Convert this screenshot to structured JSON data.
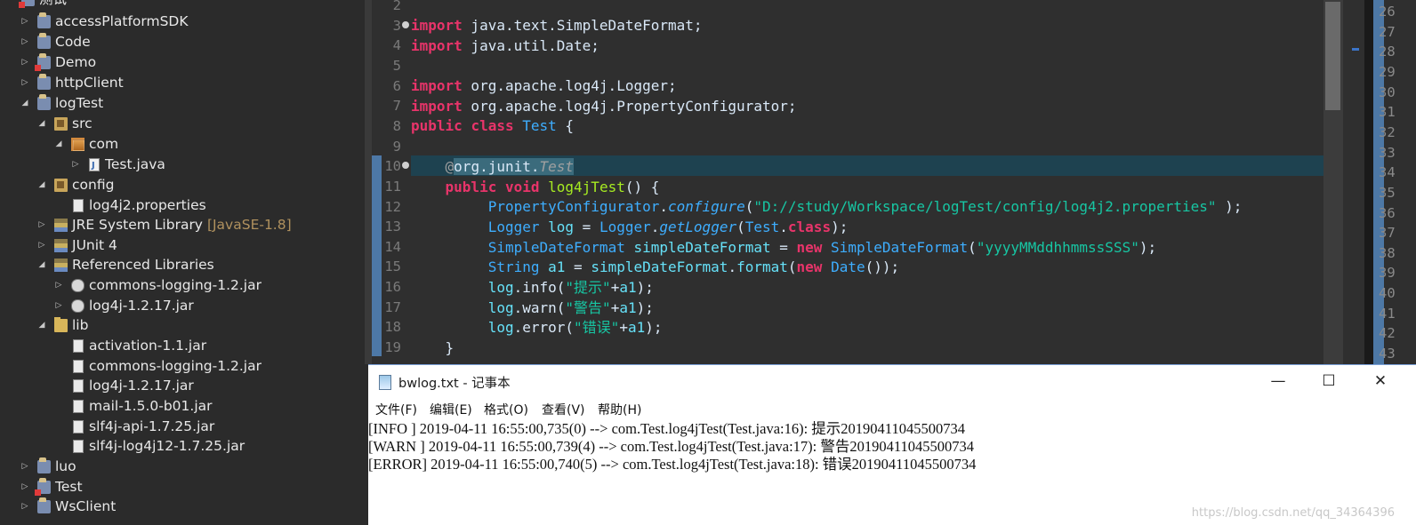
{
  "explorer": {
    "header_partial": "测试",
    "items": [
      {
        "label": "accessPlatformSDK",
        "icon": "project-icon"
      },
      {
        "label": "Code",
        "icon": "project-icon"
      },
      {
        "label": "Demo",
        "icon": "project-error-icon"
      },
      {
        "label": "httpClient",
        "icon": "project-icon"
      },
      {
        "label": "logTest",
        "icon": "project-icon"
      },
      {
        "label": "src",
        "icon": "source-folder-icon"
      },
      {
        "label": "com",
        "icon": "package-icon"
      },
      {
        "label": "Test.java",
        "icon": "java-file-icon"
      },
      {
        "label": "config",
        "icon": "source-folder-icon"
      },
      {
        "label": "log4j2.properties",
        "icon": "properties-file-icon"
      },
      {
        "label": "JRE System Library",
        "decor": "[JavaSE-1.8]",
        "icon": "library-icon"
      },
      {
        "label": "JUnit 4",
        "icon": "library-icon"
      },
      {
        "label": "Referenced Libraries",
        "icon": "library-icon"
      },
      {
        "label": "commons-logging-1.2.jar",
        "icon": "jar-icon"
      },
      {
        "label": "log4j-1.2.17.jar",
        "icon": "jar-icon"
      },
      {
        "label": "lib",
        "icon": "folder-icon"
      },
      {
        "label": "activation-1.1.jar",
        "icon": "file-icon"
      },
      {
        "label": "commons-logging-1.2.jar",
        "icon": "file-icon"
      },
      {
        "label": "log4j-1.2.17.jar",
        "icon": "file-icon"
      },
      {
        "label": "mail-1.5.0-b01.jar",
        "icon": "file-icon"
      },
      {
        "label": "slf4j-api-1.7.25.jar",
        "icon": "file-icon"
      },
      {
        "label": "slf4j-log4j12-1.7.25.jar",
        "icon": "file-icon"
      },
      {
        "label": "luo",
        "icon": "project-icon"
      },
      {
        "label": "Test",
        "icon": "project-error-icon"
      },
      {
        "label": "WsClient",
        "icon": "project-icon"
      }
    ]
  },
  "editor": {
    "line_numbers": [
      "2",
      "3",
      "4",
      "5",
      "6",
      "7",
      "8",
      "9",
      "10",
      "11",
      "12",
      "13",
      "14",
      "15",
      "16",
      "17",
      "18",
      "19"
    ],
    "right_line_numbers": [
      "26",
      "27",
      "28",
      "29",
      "30",
      "31",
      "32",
      "33",
      "34",
      "35",
      "36",
      "37",
      "38",
      "39",
      "40",
      "41",
      "42",
      "43"
    ],
    "code": {
      "l3_kw": "import",
      "l3_rest": " java.text.SimpleDateFormat;",
      "l4_kw": "import",
      "l4_rest": " java.util.Date;",
      "l6_kw": "import",
      "l6_rest": " org.apache.log4j.Logger;",
      "l7_kw": "import",
      "l7_rest": " org.apache.log4j.PropertyConfigurator;",
      "l8_kw1": "public",
      "l8_kw2": "class",
      "l8_cls": "Test",
      "l8_rest": " {",
      "l10_at": "@",
      "l10_pkg": "org.junit.",
      "l10_ann": "Test",
      "l11_kw1": "public",
      "l11_kw2": "void",
      "l11_meth": "log4jTest",
      "l11_rest": "() {",
      "l12_cls": "PropertyConfigurator",
      "l12_dot": ".",
      "l12_meth": "configure",
      "l12_open": "(",
      "l12_str": "\"D://study/Workspace/logTest/config/log4j2.properties\"",
      "l12_close": " );",
      "l13_typ": "Logger",
      "l13_var": "log",
      "l13_eq": " = ",
      "l13_cls": "Logger",
      "l13_dot": ".",
      "l13_meth": "getLogger",
      "l13_open": "(",
      "l13_cls2": "Test",
      "l13_dot2": ".",
      "l13_kw": "class",
      "l13_close": ");",
      "l14_typ": "SimpleDateFormat",
      "l14_var": "simpleDateFormat",
      "l14_eq": " = ",
      "l14_kw": "new",
      "l14_cls": "SimpleDateFormat",
      "l14_open": "(",
      "l14_str": "\"yyyyMMddhhmmssSSS\"",
      "l14_close": ");",
      "l15_typ": "String",
      "l15_var": "a1",
      "l15_eq": " = ",
      "l15_var2": "simpleDateFormat",
      "l15_dot": ".",
      "l15_meth": "format",
      "l15_open": "(",
      "l15_kw": "new",
      "l15_cls": "Date",
      "l15_close": "());",
      "l16_var": "log",
      "l16_mid": ".info(",
      "l16_str": "\"提示\"",
      "l16_plus": "+",
      "l16_var2": "a1",
      "l16_close": ");",
      "l17_var": "log",
      "l17_mid": ".warn(",
      "l17_str": "\"警告\"",
      "l17_plus": "+",
      "l17_var2": "a1",
      "l17_close": ");",
      "l18_var": "log",
      "l18_mid": ".error(",
      "l18_str": "\"错误\"",
      "l18_plus": "+",
      "l18_var2": "a1",
      "l18_close": ");",
      "l19": "}"
    }
  },
  "notepad": {
    "title": "bwlog.txt - 记事本",
    "buttons": {
      "minimize": "—",
      "maximize": "☐",
      "close": "✕"
    },
    "menu": [
      "文件(F)",
      "编辑(E)",
      "格式(O)",
      "查看(V)",
      "帮助(H)"
    ],
    "lines": [
      "[INFO ] 2019-04-11 16:55:00,735(0) --> com.Test.log4jTest(Test.java:16): 提示20190411045500734",
      "[WARN ] 2019-04-11 16:55:00,739(4) --> com.Test.log4jTest(Test.java:17): 警告20190411045500734",
      "[ERROR] 2019-04-11 16:55:00,740(5) --> com.Test.log4jTest(Test.java:18): 错误20190411045500734"
    ],
    "watermark": "https://blog.csdn.net/qq_34364396"
  }
}
